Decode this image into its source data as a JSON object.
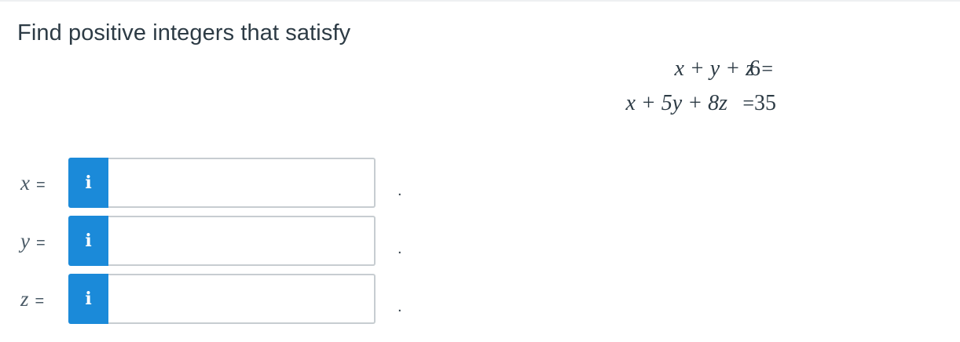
{
  "question": {
    "prompt": "Find positive integers that satisfy",
    "equations": [
      {
        "lhs": "x + y + z",
        "eq": "=",
        "rhs": "6"
      },
      {
        "lhs": "x + 5y + 8z",
        "eq": "=",
        "rhs": "35"
      }
    ]
  },
  "answers": [
    {
      "variable": "x",
      "eq": "=",
      "info_glyph": "i",
      "value": "",
      "placeholder": "",
      "suffix": "."
    },
    {
      "variable": "y",
      "eq": "=",
      "info_glyph": "i",
      "value": "",
      "placeholder": "",
      "suffix": "."
    },
    {
      "variable": "z",
      "eq": "=",
      "info_glyph": "i",
      "value": "",
      "placeholder": "",
      "suffix": "."
    }
  ],
  "colors": {
    "info_button": "#1b8ad9",
    "text": "#2d3b45",
    "input_border": "#c7cdd1"
  },
  "icons": {
    "info": "info-icon"
  }
}
